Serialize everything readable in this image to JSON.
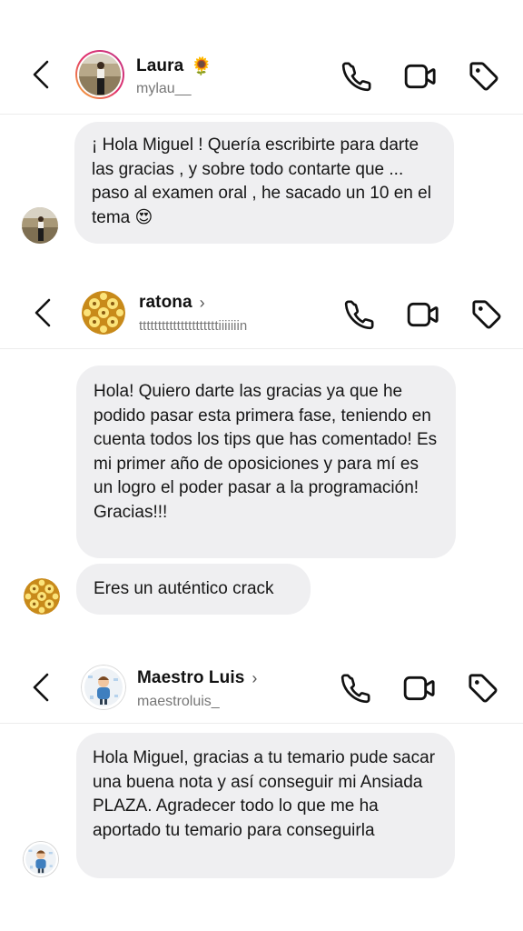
{
  "chats": [
    {
      "name": "Laura",
      "name_emoji": "🌻",
      "username": "mylau__",
      "show_chevron": false,
      "messages": [
        "¡ Hola Miguel ! Quería escribirte para darte las gracias , y sobre todo contarte que ... paso al examen oral , he sacado un 10 en el tema 😍"
      ]
    },
    {
      "name": "ratona",
      "chevron": "›",
      "username": "tttttttttttttttttttttiiiiiiin",
      "messages": [
        "Hola! Quiero darte las gracias ya que he podido pasar esta primera fase, teniendo en cuenta todos los tips que has comentado! Es mi primer año de oposiciones y para mí es un logro el poder pasar a la programación! Gracias!!!",
        "Eres un auténtico crack"
      ]
    },
    {
      "name": "Maestro Luis",
      "chevron": "›",
      "username": "maestroluis_",
      "messages": [
        "Hola Miguel, gracias a tu temario pude sacar una buena nota y así conseguir mi Ansiada PLAZA. Agradecer todo lo que me ha aportado tu temario para conseguirla"
      ]
    }
  ],
  "icons": {
    "back": "chevron-left-icon",
    "call": "phone-icon",
    "video": "video-camera-icon",
    "tag": "tag-icon"
  },
  "colors": {
    "bubble": "#efeff1",
    "story_ring_start": "#f7b733",
    "story_ring_end": "#d62976"
  }
}
